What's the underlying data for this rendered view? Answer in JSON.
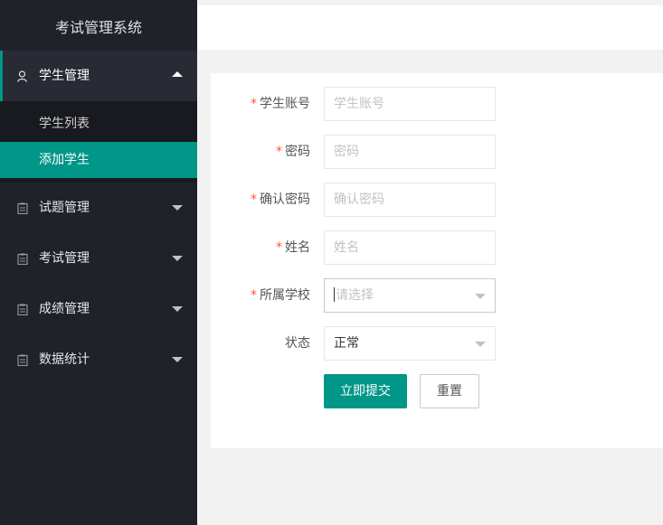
{
  "sidebar": {
    "title": "考试管理系统",
    "groups": [
      {
        "label": "学生管理",
        "icon": "user-icon",
        "expanded": true
      },
      {
        "label": "试题管理",
        "icon": "clipboard-icon",
        "expanded": false
      },
      {
        "label": "考试管理",
        "icon": "clipboard-icon",
        "expanded": false
      },
      {
        "label": "成绩管理",
        "icon": "clipboard-icon",
        "expanded": false
      },
      {
        "label": "数据统计",
        "icon": "clipboard-icon",
        "expanded": false
      }
    ],
    "sub_items": [
      {
        "label": "学生列表",
        "active": false
      },
      {
        "label": "添加学生",
        "active": true
      }
    ]
  },
  "form": {
    "fields": [
      {
        "label": "学生账号",
        "required": true,
        "placeholder": "学生账号",
        "value": ""
      },
      {
        "label": "密码",
        "required": true,
        "placeholder": "密码",
        "value": ""
      },
      {
        "label": "确认密码",
        "required": true,
        "placeholder": "确认密码",
        "value": ""
      },
      {
        "label": "姓名",
        "required": true,
        "placeholder": "姓名",
        "value": ""
      },
      {
        "label": "所属学校",
        "required": true,
        "placeholder": "请选择",
        "value": ""
      },
      {
        "label": "状态",
        "required": false,
        "placeholder": "",
        "value": "正常"
      }
    ],
    "required_mark": "*",
    "submit_label": "立即提交",
    "reset_label": "重置"
  },
  "colors": {
    "sidebar_bg": "#20222a",
    "accent": "#009688",
    "required": "#ff5722"
  }
}
